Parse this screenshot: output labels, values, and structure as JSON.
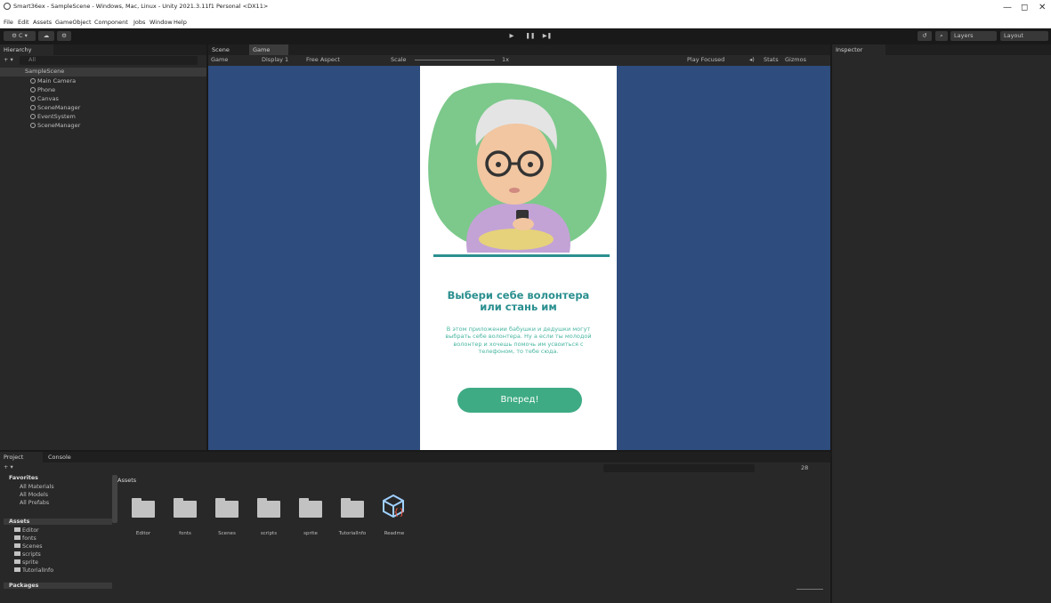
{
  "window": {
    "title": "Smart36ex - SampleScene - Windows, Mac, Linux - Unity 2021.3.11f1 Personal <DX11>",
    "controls": [
      "—",
      "◻",
      "✕"
    ]
  },
  "menu": [
    "File",
    "Edit",
    "Assets",
    "GameObject",
    "Component",
    "Jobs",
    "Window",
    "Help"
  ],
  "toolbar": {
    "account": "⚙ C ▾",
    "layers": "Layers",
    "layout": "Layout",
    "play": "▶",
    "pause": "❚❚",
    "step": "▶❚"
  },
  "hierarchy": {
    "tab": "Hierarchy",
    "search_placeholder": "All",
    "scene": "SampleScene",
    "items": [
      "Main Camera",
      "Phone",
      "Canvas",
      "SceneManager",
      "EventSystem",
      "SceneManager"
    ]
  },
  "center": {
    "tabs": [
      "Scene",
      "Game"
    ],
    "game_bar": {
      "display_mode": "Game",
      "display": "Display 1",
      "aspect": "Free Aspect",
      "scale_label": "Scale",
      "scale_value": "1x",
      "play_focused": "Play Focused",
      "stats": "Stats",
      "gizmos": "Gizmos"
    }
  },
  "inspector": {
    "tab": "Inspector"
  },
  "game": {
    "heading_line1": "Выбери себе волонтера",
    "heading_line2": "или стань им",
    "body": "В этом приложении бабушки и дедушки могут выбрать себе волонтера. Ну а если ты молодой волонтер и хочешь помочь им усвоиться с телефоном, то тебе сюда.",
    "button": "Вперед!",
    "colors": {
      "accent": "#2b8f8f",
      "button": "#3eab84",
      "blob": "#7cc98b",
      "background": "#2e4c7e"
    }
  },
  "bottom": {
    "tabs": [
      "Project",
      "Console"
    ],
    "favorites_label": "Favorites",
    "favorites": [
      "All Materials",
      "All Models",
      "All Prefabs"
    ],
    "assets_label": "Assets",
    "asset_tree": [
      "Editor",
      "fonts",
      "Scenes",
      "scripts",
      "sprite",
      "TutorialInfo"
    ],
    "packages_label": "Packages",
    "breadcrumb": "Assets",
    "assets": [
      "Editor",
      "fonts",
      "Scenes",
      "scripts",
      "sprite",
      "TutorialInfo",
      "Readme"
    ],
    "hidden_count": "28"
  }
}
